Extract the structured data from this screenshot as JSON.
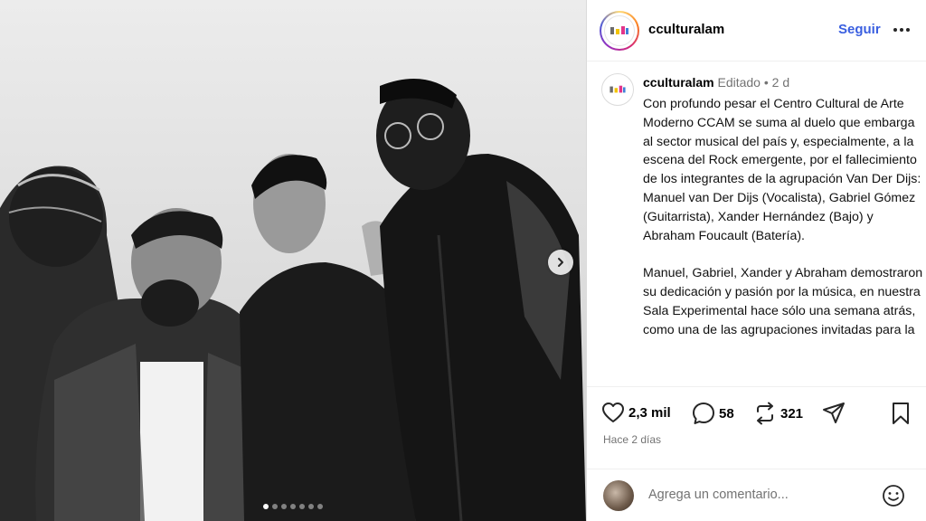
{
  "post": {
    "username": "cculturalam",
    "follow_label": "Seguir",
    "caption_meta_edited": "Editado",
    "caption_meta_sep": "•",
    "caption_meta_time": "2 d",
    "caption_paragraphs": [
      "Con profundo pesar el Centro Cultural de Arte Moderno CCAM se suma al duelo que embarga al sector musical del país y, especialmente, a la escena del Rock emergente, por el fallecimiento de los integrantes de la agrupación Van Der Dijs: Manuel van Der Dijs (Vocalista), Gabriel Gómez (Guitarrista), Xander Hernández (Bajo) y Abraham Foucault (Batería).",
      "Manuel, Gabriel, Xander y Abraham demostraron su dedicación y pasión por la música, en nuestra Sala Experimental hace sólo una semana atrás, como una de las agrupaciones invitadas para la"
    ],
    "likes": "2,3 mil",
    "comments": "58",
    "reposts": "321",
    "timestamp": "Hace 2 días"
  },
  "comment_bar": {
    "placeholder": "Agrega un comentario..."
  },
  "carousel": {
    "slide_count": 7,
    "active_index": 0
  },
  "icons": {
    "more": "more-horizontal-icon",
    "like": "heart-icon",
    "comment": "comment-bubble-icon",
    "repost": "repost-icon",
    "share": "paper-plane-icon",
    "save": "bookmark-icon",
    "emoji": "smiley-icon",
    "next": "chevron-right-icon"
  },
  "colors": {
    "follow": "#3a5fe0",
    "muted": "#737373"
  }
}
